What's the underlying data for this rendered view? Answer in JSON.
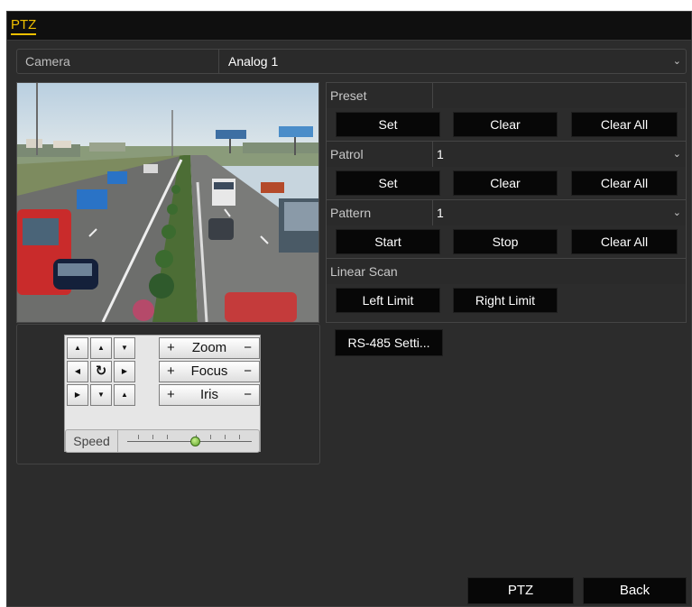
{
  "window": {
    "title": "PTZ"
  },
  "camera": {
    "label": "Camera",
    "value": "Analog 1"
  },
  "preset": {
    "label": "Preset",
    "set": "Set",
    "clear": "Clear",
    "clear_all": "Clear All"
  },
  "patrol": {
    "label": "Patrol",
    "value": "1",
    "set": "Set",
    "clear": "Clear",
    "clear_all": "Clear All"
  },
  "pattern": {
    "label": "Pattern",
    "value": "1",
    "start": "Start",
    "stop": "Stop",
    "clear_all": "Clear All"
  },
  "linear_scan": {
    "label": "Linear Scan",
    "left_limit": "Left Limit",
    "right_limit": "Right Limit"
  },
  "rs485": {
    "label": "RS-485 Setti..."
  },
  "controls": {
    "zoom": {
      "plus": "+",
      "label": "Zoom",
      "minus": "−"
    },
    "focus": {
      "plus": "+",
      "label": "Focus",
      "minus": "−"
    },
    "iris": {
      "plus": "+",
      "label": "Iris",
      "minus": "−"
    },
    "speed_label": "Speed",
    "speed_level": 0.55
  },
  "footer": {
    "ptz": "PTZ",
    "back": "Back"
  },
  "colors": {
    "title_accent": "#f0c000",
    "button_bg": "#070707",
    "panel_bg": "#2c2c2c"
  }
}
